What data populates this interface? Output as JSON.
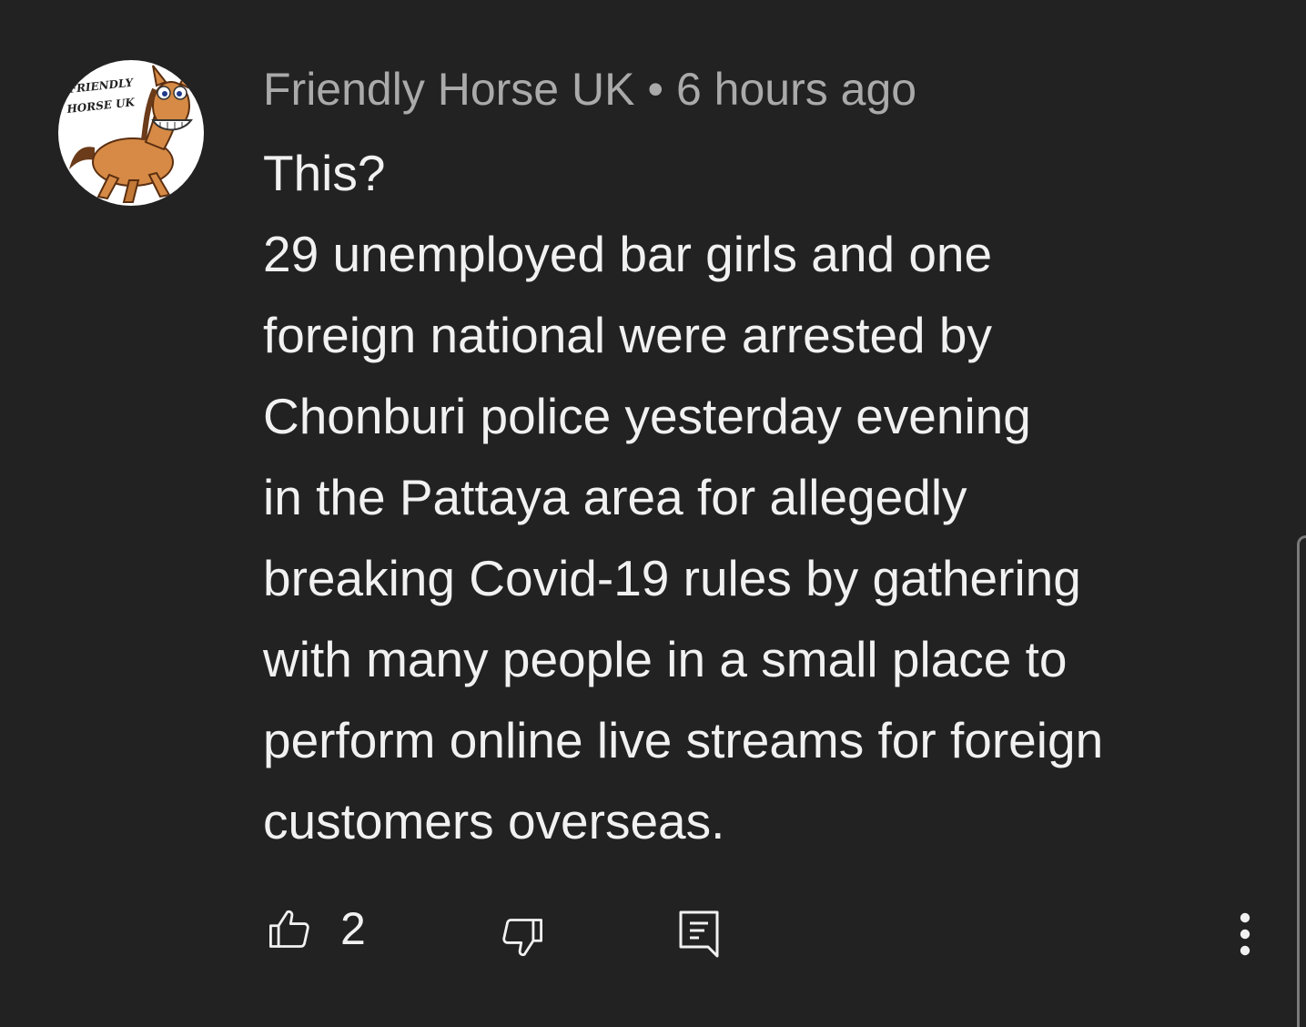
{
  "comment": {
    "author": "Friendly Horse UK",
    "separator": "•",
    "timestamp": "6 hours ago",
    "avatar_logo_text": "FRIENDLY HORSE UK",
    "avatar_icon": "horse-cartoon-avatar",
    "body_lines": [
      "This?",
      "29 unemployed bar girls and one",
      "foreign national were arrested by",
      "Chonburi police yesterday evening",
      "in the Pattaya area for allegedly",
      "breaking Covid-19 rules by gathering",
      "with many people in a small place to",
      "perform online live streams for foreign",
      "customers overseas."
    ]
  },
  "actions": {
    "like_icon": "thumbs-up-icon",
    "like_count": "2",
    "dislike_icon": "thumbs-down-icon",
    "reply_icon": "reply-comment-icon",
    "more_icon": "vertical-ellipsis-icon"
  },
  "colors": {
    "background": "#222222",
    "meta_text": "#aaaaaa",
    "body_text": "#f1f1f1"
  }
}
